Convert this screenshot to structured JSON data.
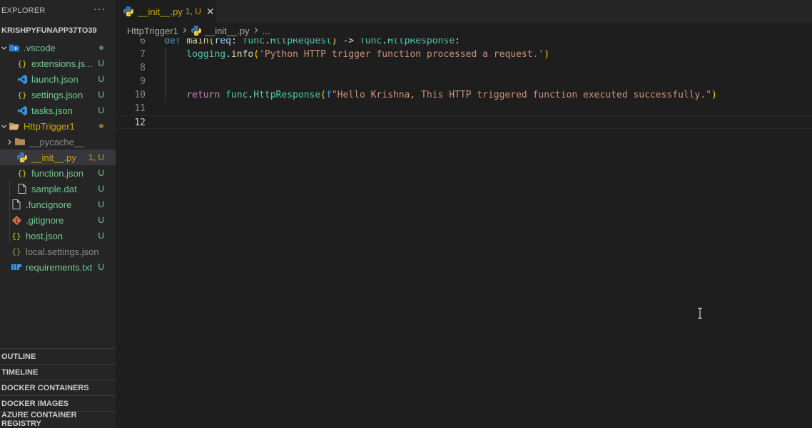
{
  "explorer": {
    "title": "EXPLORER",
    "more": "···",
    "project": "KRISHPYFUNAPP37TO39"
  },
  "tree": [
    {
      "label": "extensions.js...",
      "status": "U",
      "color": "green",
      "icon": "json-braces-icon"
    },
    {
      "label": "launch.json",
      "status": "U",
      "color": "green",
      "icon": "vscode-icon"
    },
    {
      "label": "settings.json",
      "status": "U",
      "color": "green",
      "icon": "json-braces-icon"
    },
    {
      "label": "tasks.json",
      "status": "U",
      "color": "green",
      "icon": "vscode-icon"
    },
    {
      "label": "__pycache__",
      "status": "",
      "color": "gray",
      "icon": "folder-icon"
    },
    {
      "label": "__init__.py",
      "status": "1, U",
      "color": "yellow",
      "icon": "python-icon"
    },
    {
      "label": "function.json",
      "status": "U",
      "color": "green",
      "icon": "json-braces-icon"
    },
    {
      "label": "sample.dat",
      "status": "U",
      "color": "green",
      "icon": "file-icon"
    },
    {
      "label": ".funcignore",
      "status": "U",
      "color": "green",
      "icon": "file-icon"
    },
    {
      "label": ".gitignore",
      "status": "U",
      "color": "green",
      "icon": "git-icon"
    },
    {
      "label": "host.json",
      "status": "U",
      "color": "green",
      "icon": "json-braces-icon"
    },
    {
      "label": "local.settings.json",
      "status": "",
      "color": "gray",
      "icon": "json-braces-icon"
    },
    {
      "label": "requirements.txt",
      "status": "U",
      "color": "green",
      "icon": "requirements-icon"
    }
  ],
  "folders": {
    "vscode": {
      "label": ".vscode",
      "dot_color": "#73c991"
    },
    "httptrigger": {
      "label": "HttpTrigger1",
      "dot_color": "#8f7631"
    }
  },
  "panels": [
    "OUTLINE",
    "TIMELINE",
    "DOCKER CONTAINERS",
    "DOCKER IMAGES",
    "AZURE CONTAINER REGISTRY"
  ],
  "tab": {
    "name": "__init__.py",
    "status": "1, U",
    "close": "✕"
  },
  "breadcrumb": {
    "folder": "HttpTrigger1",
    "file": "__init__.py",
    "more": "..."
  },
  "code": {
    "line_numbers": [
      "6",
      "7",
      "8",
      "9",
      "10",
      "11",
      "12"
    ],
    "line6": {
      "k_def": "def",
      "fn": "main",
      "p_open": "(",
      "param": "req",
      "colon": ": ",
      "mod": "func",
      "dot": ".",
      "type": "HttpRequest",
      "p_close": ")",
      "arrow": " -> ",
      "mod2": "func",
      "dot2": ".",
      "type2": "HttpResponse",
      "end": ":"
    },
    "line7": {
      "mod": "logging",
      "dot": ".",
      "fn": "info",
      "open": "(",
      "str": "'Python HTTP trigger function processed a request.'",
      "close": ")"
    },
    "line10": {
      "kw": "return",
      "mod": "func",
      "dot": ".",
      "fn": "HttpResponse",
      "open": "(",
      "prefix": "f",
      "str": "\"Hello Krishna, This HTTP triggered function executed successfully.\"",
      "close": ")"
    }
  }
}
